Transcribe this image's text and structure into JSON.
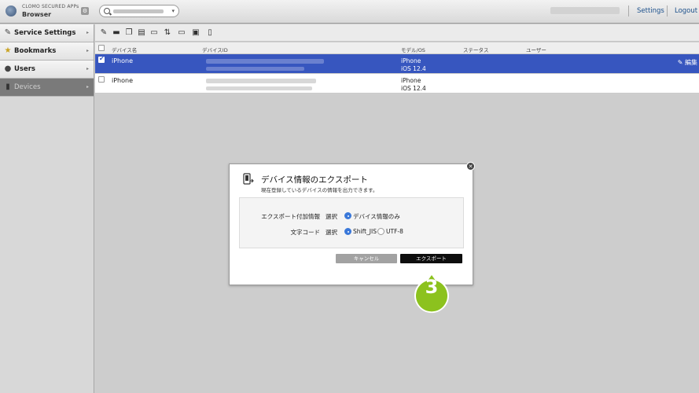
{
  "app": {
    "caption": "CLOMO SECURED APPs",
    "name": "Browser"
  },
  "top_links": {
    "settings": "Settings",
    "logout": "Logout"
  },
  "sidebar": {
    "items": [
      {
        "label": "Service Settings",
        "icon": "wrench-icon"
      },
      {
        "label": "Bookmarks",
        "icon": "star-icon"
      },
      {
        "label": "Users",
        "icon": "user-icon"
      },
      {
        "label": "Devices",
        "icon": "device-icon",
        "active": true
      }
    ]
  },
  "table": {
    "headers": [
      "デバイス名",
      "デバイスID",
      "モデル/OS",
      "ステータス",
      "ユーザー"
    ],
    "rows": [
      {
        "name": "iPhone",
        "model": "iPhone",
        "os": "iOS 12.4",
        "selected": true,
        "action": "編集"
      },
      {
        "name": "iPhone",
        "model": "iPhone",
        "os": "iOS 12.4",
        "selected": false
      }
    ]
  },
  "modal": {
    "title": "デバイス情報のエクスポート",
    "description": "現在登録しているデバイスの情報を出力できます。",
    "fields": [
      {
        "label": "エクスポート付加情報",
        "select": "選択",
        "options": [
          "デバイス情報のみ"
        ],
        "selected": "デバイス情報のみ"
      },
      {
        "label": "文字コード",
        "select": "選択",
        "options": [
          "Shift_JIS",
          "UTF-8"
        ],
        "selected": "Shift_JIS"
      }
    ],
    "cancel_label": "キャンセル",
    "export_label": "エクスポート"
  },
  "step_marker": "3",
  "colors": {
    "selected_row": "#3756bf",
    "step_marker": "#8cc21e",
    "radio_on": "#3a78d9"
  }
}
